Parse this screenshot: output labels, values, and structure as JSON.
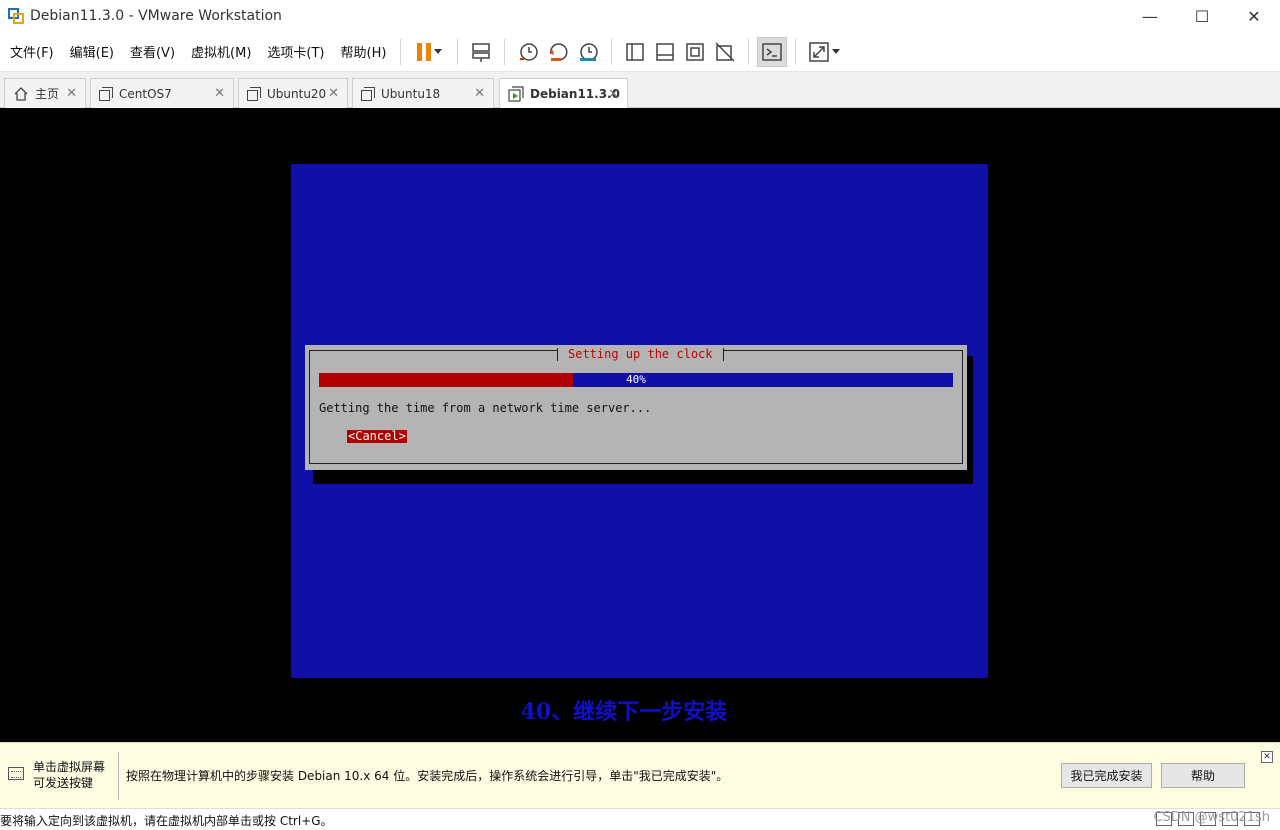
{
  "window": {
    "title": "Debian11.3.0 - VMware Workstation"
  },
  "menu": [
    "文件(F)",
    "编辑(E)",
    "查看(V)",
    "虚拟机(M)",
    "选项卡(T)",
    "帮助(H)"
  ],
  "tabs": [
    {
      "label": "主页",
      "icon": "home-icon",
      "active": false
    },
    {
      "label": "CentOS7",
      "icon": "vm-icon",
      "active": false
    },
    {
      "label": "Ubuntu20",
      "icon": "vm-icon",
      "active": false
    },
    {
      "label": "Ubuntu18",
      "icon": "vm-icon",
      "active": false
    },
    {
      "label": "Debian11.3.0",
      "icon": "vm-running-icon",
      "active": true
    }
  ],
  "installer": {
    "dialog_title": "Setting up the clock",
    "progress_percent": 40,
    "progress_label": "40%",
    "message": "Getting the time from a network time server...",
    "cancel_label": "<Cancel>"
  },
  "caption": "40、继续下一步安装",
  "hint": {
    "left_line1": "单击虚拟屏幕",
    "left_line2": "可发送按键",
    "text": "按照在物理计算机中的步骤安装 Debian 10.x 64 位。安装完成后，操作系统会进行引导，单击\"我已完成安装\"。",
    "done_button": "我已完成安装",
    "help_button": "帮助"
  },
  "status": {
    "text": "要将输入定向到该虚拟机，请在虚拟机内部单击或按 Ctrl+G。",
    "watermark": "CSDN @wst021sh"
  },
  "colors": {
    "installer_blue": "#1010a8",
    "progress_red": "#b00000",
    "dialog_gray": "#b4b4b4",
    "pause_orange": "#f08000",
    "caption_blue": "#1010c8"
  }
}
